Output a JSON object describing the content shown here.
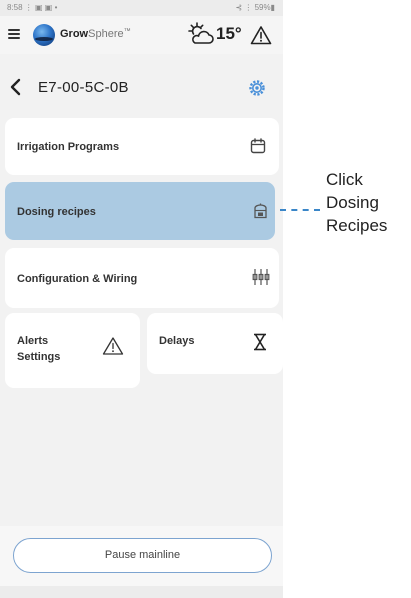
{
  "status_bar": {
    "left": "8:58 ⋮ ▣ ▣ •",
    "right": "⊰ ⋮ 59%▮"
  },
  "header": {
    "brand_grow": "Grow",
    "brand_sphere": "Sphere",
    "brand_mark": "™",
    "weather_icon": "sun-cloud-icon",
    "temperature": "15°",
    "alert_icon": "warning-triangle-icon"
  },
  "device": {
    "back_icon": "chevron-left-icon",
    "id": "E7-00-5C-0B",
    "settings_icon": "gear-icon"
  },
  "menu": {
    "irrigation": {
      "label": "Irrigation Programs",
      "icon": "calendar-icon"
    },
    "dosing": {
      "label": "Dosing recipes",
      "icon": "dosing-tank-icon",
      "selected": true
    },
    "config": {
      "label": "Configuration & Wiring",
      "icon": "wiring-sliders-icon"
    },
    "alerts": {
      "label_line1": "Alerts",
      "label_line2": "Settings",
      "icon": "warning-triangle-icon"
    },
    "delays": {
      "label": "Delays",
      "icon": "hourglass-icon"
    }
  },
  "bottom": {
    "pause_label": "Pause mainline"
  },
  "callout": {
    "line1": "Click",
    "line2": "Dosing",
    "line3": "Recipes"
  },
  "colors": {
    "selected_card": "#abcae2",
    "callout_line": "#3a86c8",
    "button_border": "#7da4d0"
  }
}
